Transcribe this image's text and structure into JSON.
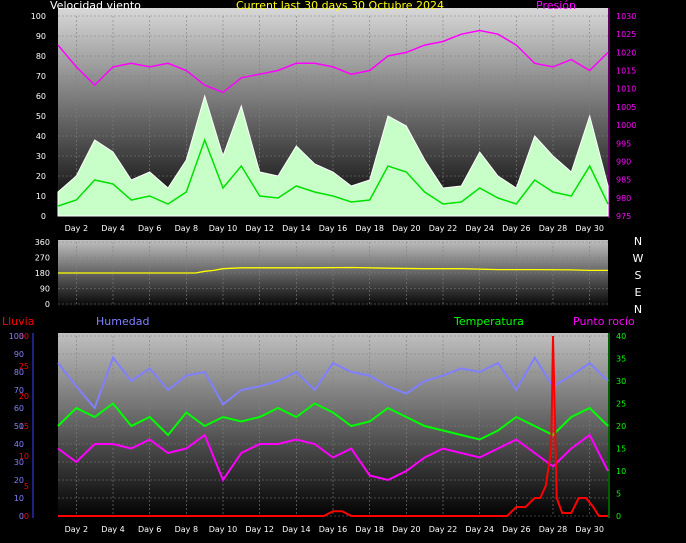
{
  "colors": {
    "wind_gust": "#ffffff",
    "wind_avg": "#00e000",
    "wind_fill": "#c8ffc8",
    "pressure": "#ff00ff",
    "direction": "#ffff00",
    "humidity": "#8080ff",
    "temperature": "#00ff00",
    "dewpoint": "#ff00ff",
    "rain": "#ff0000",
    "title": "#ffff00",
    "rain_axis": "#ff0000"
  },
  "chart_data": [
    {
      "type": "area",
      "title": "Current last 30 days 30 Octubre 2024",
      "left_label": "Velocidad viento",
      "right_label": "Presión",
      "x_ticks": [
        "Day 2",
        "Day 4",
        "Day 6",
        "Day 8",
        "Day 10",
        "Day 12",
        "Day 14",
        "Day 16",
        "Day 18",
        "Day 20",
        "Day 22",
        "Day 24",
        "Day 26",
        "Day 28",
        "Day 30"
      ],
      "y_left_ticks": [
        "100",
        "90",
        "80",
        "70",
        "60",
        "50",
        "40",
        "30",
        "20",
        "10",
        "0"
      ],
      "y_left_range": [
        0,
        100
      ],
      "y_right_ticks": [
        "1030",
        "1025",
        "1020",
        "1015",
        "1010",
        "1005",
        "1000",
        "995",
        "990",
        "985",
        "980",
        "975"
      ],
      "y_right_range": [
        975,
        1030
      ],
      "x_range": [
        1,
        31
      ],
      "grid": true,
      "series": [
        {
          "key": "gust",
          "x": [
            1,
            2,
            3,
            4,
            5,
            6,
            7,
            8,
            9,
            10,
            11,
            12,
            13,
            14,
            15,
            16,
            17,
            18,
            19,
            20,
            21,
            22,
            23,
            24,
            25,
            26,
            27,
            28,
            29,
            30,
            31
          ],
          "values": [
            12,
            20,
            38,
            32,
            18,
            22,
            14,
            28,
            60,
            30,
            55,
            22,
            20,
            35,
            26,
            22,
            15,
            18,
            50,
            45,
            28,
            14,
            15,
            32,
            20,
            14,
            40,
            30,
            22,
            50,
            15
          ]
        },
        {
          "key": "avg",
          "x": [
            1,
            2,
            3,
            4,
            5,
            6,
            7,
            8,
            9,
            10,
            11,
            12,
            13,
            14,
            15,
            16,
            17,
            18,
            19,
            20,
            21,
            22,
            23,
            24,
            25,
            26,
            27,
            28,
            29,
            30,
            31
          ],
          "values": [
            5,
            8,
            18,
            16,
            8,
            10,
            6,
            12,
            38,
            14,
            25,
            10,
            9,
            15,
            12,
            10,
            7,
            8,
            25,
            22,
            12,
            6,
            7,
            14,
            9,
            6,
            18,
            12,
            10,
            25,
            6
          ]
        },
        {
          "key": "pressure",
          "x": [
            1,
            2,
            3,
            4,
            5,
            6,
            7,
            8,
            9,
            10,
            11,
            12,
            13,
            14,
            15,
            16,
            17,
            18,
            19,
            20,
            21,
            22,
            23,
            24,
            25,
            26,
            27,
            28,
            29,
            30,
            31
          ],
          "values": [
            1022,
            1016,
            1011,
            1016,
            1017,
            1016,
            1017,
            1015,
            1011,
            1009,
            1013,
            1014,
            1015,
            1017,
            1017,
            1016,
            1014,
            1015,
            1019,
            1020,
            1022,
            1023,
            1025,
            1026,
            1025,
            1022,
            1017,
            1016,
            1018,
            1015,
            1020
          ]
        }
      ]
    },
    {
      "type": "line",
      "x_ticks": [
        "Day 2",
        "Day 4",
        "Day 6",
        "Day 8",
        "Day 10",
        "Day 12",
        "Day 14",
        "Day 16",
        "Day 18",
        "Day 20",
        "Day 22",
        "Day 24",
        "Day 26",
        "Day 28",
        "Day 30"
      ],
      "y_ticks": [
        "360",
        "270",
        "180",
        "90",
        "0"
      ],
      "y_range": [
        0,
        360
      ],
      "x_range": [
        1,
        31
      ],
      "compass": [
        "N",
        "W",
        "S",
        "E",
        "N"
      ],
      "series": [
        {
          "key": "direction",
          "x": [
            1,
            3,
            5,
            7,
            8.5,
            9,
            9.5,
            10,
            11,
            13,
            15,
            17,
            19,
            21,
            23,
            25,
            27,
            29,
            30,
            31
          ],
          "values": [
            180,
            180,
            180,
            180,
            180,
            190,
            195,
            205,
            210,
            210,
            210,
            212,
            208,
            205,
            205,
            200,
            200,
            198,
            195,
            195
          ]
        }
      ]
    },
    {
      "type": "line",
      "left_outer_label": "Lluvia",
      "left_inner_label": "Humedad",
      "temp_label": "Temperatura",
      "right_label": "Punto rocío",
      "x_ticks": [
        "Day 2",
        "Day 4",
        "Day 6",
        "Day 8",
        "Day 10",
        "Day 12",
        "Day 14",
        "Day 16",
        "Day 18",
        "Day 20",
        "Day 22",
        "Day 24",
        "Day 26",
        "Day 28",
        "Day 30"
      ],
      "rain_ticks": [
        "30",
        "25",
        "20",
        "15",
        "10",
        "5",
        "0"
      ],
      "rain_range": [
        0,
        30
      ],
      "hum_ticks": [
        "100",
        "90",
        "80",
        "70",
        "60",
        "50",
        "40",
        "30",
        "20",
        "10",
        "0"
      ],
      "hum_range": [
        0,
        100
      ],
      "temp_ticks": [
        "40",
        "35",
        "30",
        "25",
        "20",
        "15",
        "10",
        "5",
        "0"
      ],
      "temp_range": [
        0,
        40
      ],
      "x_range": [
        1,
        31
      ],
      "series": [
        {
          "key": "humidity",
          "x": [
            1,
            2,
            3,
            4,
            5,
            6,
            7,
            8,
            9,
            10,
            11,
            12,
            13,
            14,
            15,
            16,
            17,
            18,
            19,
            20,
            21,
            22,
            23,
            24,
            25,
            26,
            27,
            28,
            29,
            30,
            31
          ],
          "values": [
            85,
            72,
            60,
            88,
            75,
            82,
            70,
            78,
            80,
            62,
            70,
            72,
            75,
            80,
            70,
            85,
            80,
            78,
            72,
            68,
            75,
            78,
            82,
            80,
            85,
            70,
            88,
            72,
            78,
            85,
            75
          ]
        },
        {
          "key": "temperature",
          "x": [
            1,
            2,
            3,
            4,
            5,
            6,
            7,
            8,
            9,
            10,
            11,
            12,
            13,
            14,
            15,
            16,
            17,
            18,
            19,
            20,
            21,
            22,
            23,
            24,
            25,
            26,
            27,
            28,
            29,
            30,
            31
          ],
          "values": [
            20,
            24,
            22,
            25,
            20,
            22,
            18,
            23,
            20,
            22,
            21,
            22,
            24,
            22,
            25,
            23,
            20,
            21,
            24,
            22,
            20,
            19,
            18,
            17,
            19,
            22,
            20,
            18,
            22,
            24,
            20
          ]
        },
        {
          "key": "dewpoint",
          "x": [
            1,
            2,
            3,
            4,
            5,
            6,
            7,
            8,
            9,
            10,
            11,
            12,
            13,
            14,
            15,
            16,
            17,
            18,
            19,
            20,
            21,
            22,
            23,
            24,
            25,
            26,
            27,
            28,
            29,
            30,
            31
          ],
          "values": [
            15,
            12,
            16,
            16,
            15,
            17,
            14,
            15,
            18,
            8,
            14,
            16,
            16,
            17,
            16,
            13,
            15,
            9,
            8,
            10,
            13,
            15,
            14,
            13,
            15,
            17,
            14,
            11,
            15,
            18,
            10
          ]
        },
        {
          "key": "rain",
          "x": [
            1,
            15.5,
            16,
            16.5,
            17,
            25.5,
            26,
            26.5,
            27,
            27.3,
            27.6,
            27.9,
            28,
            28.2,
            28.5,
            29,
            29.4,
            29.8,
            30.2,
            30.5,
            31
          ],
          "values": [
            0,
            0,
            0.8,
            0.8,
            0,
            0,
            1.5,
            1.5,
            3,
            3,
            5,
            11,
            30,
            3,
            0.5,
            0.5,
            3,
            3,
            1.5,
            0,
            0
          ]
        }
      ]
    }
  ]
}
